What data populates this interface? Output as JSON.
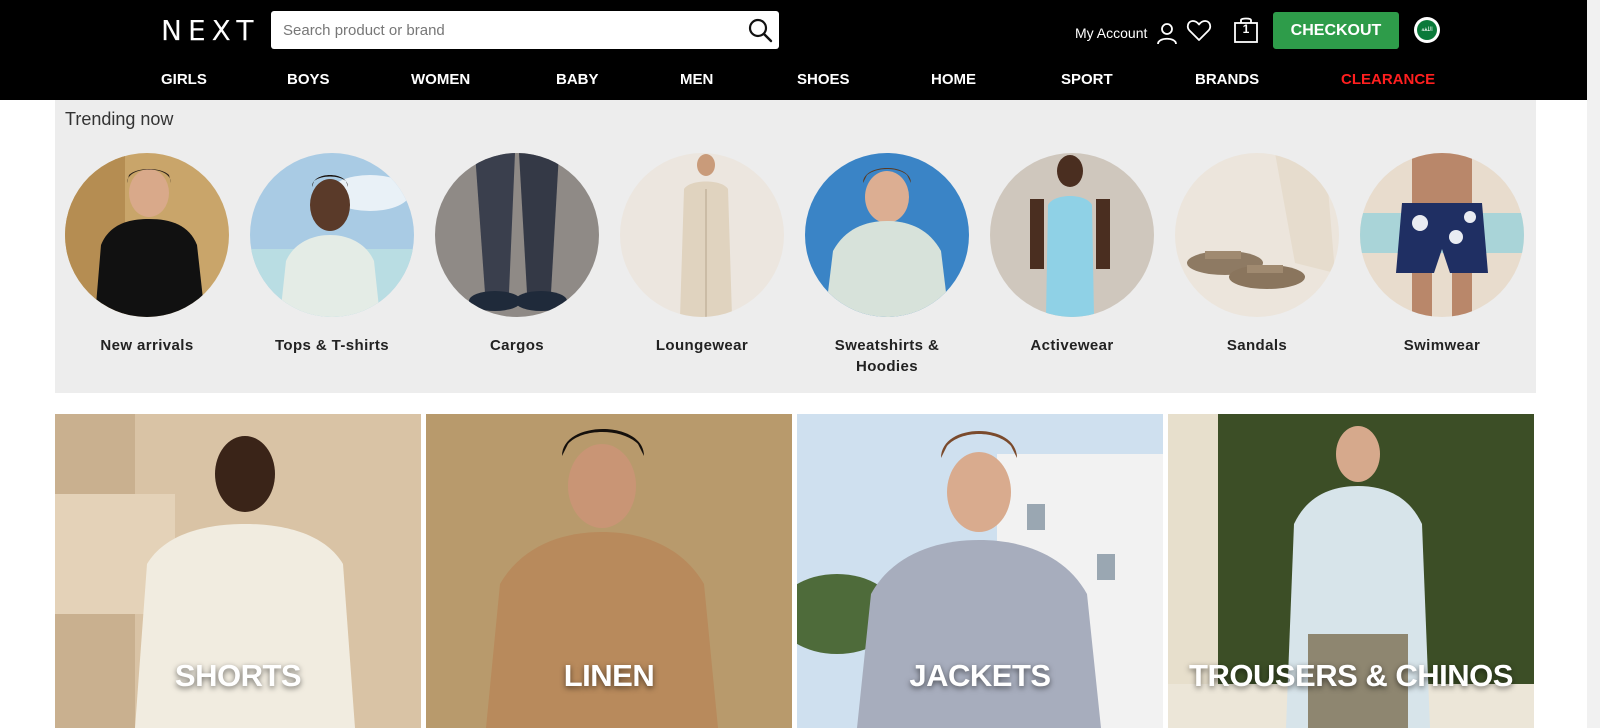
{
  "header": {
    "logo": "NEXT",
    "search_placeholder": "Search product or brand",
    "account_label": "My Account",
    "bag_count": "1",
    "checkout_label": "CHECKOUT",
    "flag_text": "اللغة"
  },
  "nav": {
    "items": [
      {
        "label": "GIRLS"
      },
      {
        "label": "BOYS"
      },
      {
        "label": "WOMEN"
      },
      {
        "label": "BABY"
      },
      {
        "label": "MEN"
      },
      {
        "label": "SHOES"
      },
      {
        "label": "HOME"
      },
      {
        "label": "SPORT"
      },
      {
        "label": "BRANDS"
      },
      {
        "label": "CLEARANCE"
      }
    ]
  },
  "trending": {
    "title": "Trending now",
    "items": [
      {
        "label": "New arrivals"
      },
      {
        "label": "Tops & T-shirts"
      },
      {
        "label": "Cargos"
      },
      {
        "label": "Loungewear"
      },
      {
        "label": "Sweatshirts & Hoodies"
      },
      {
        "label": "Activewear"
      },
      {
        "label": "Sandals"
      },
      {
        "label": "Swimwear"
      }
    ]
  },
  "tiles": [
    {
      "label": "SHORTS"
    },
    {
      "label": "LINEN"
    },
    {
      "label": "JACKETS"
    },
    {
      "label": "TROUSERS & CHINOS"
    }
  ],
  "colors": {
    "header_bg": "#000000",
    "checkout_bg": "#2e9c4a",
    "clearance": "#ff1f1f",
    "trending_bg": "#ededed"
  }
}
